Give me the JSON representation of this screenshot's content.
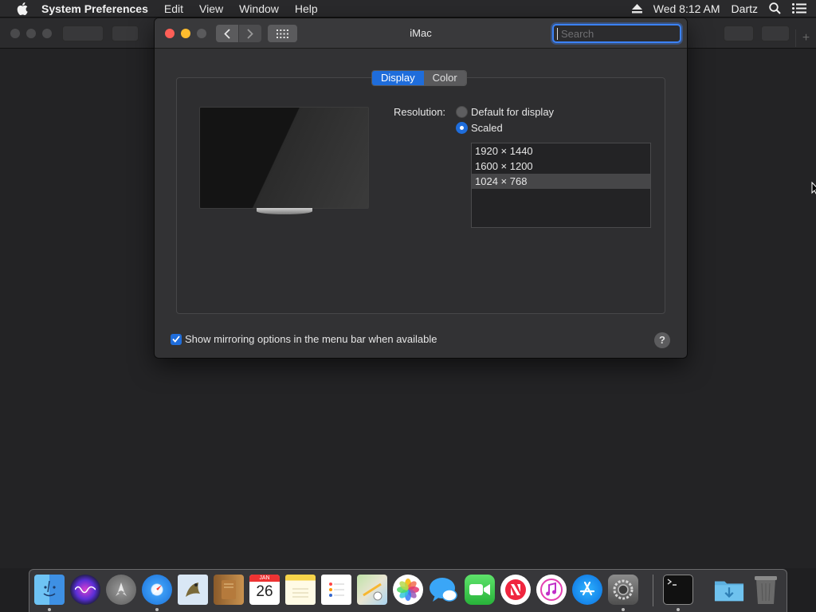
{
  "menubar": {
    "app_name": "System Preferences",
    "items": [
      "Edit",
      "View",
      "Window",
      "Help"
    ],
    "clock": "Wed 8:12 AM",
    "user": "Dartz"
  },
  "window": {
    "title": "iMac",
    "search_placeholder": "Search"
  },
  "tabs": [
    {
      "label": "Display",
      "active": true
    },
    {
      "label": "Color",
      "active": false
    }
  ],
  "resolution": {
    "label": "Resolution:",
    "options": [
      {
        "label": "Default for display",
        "selected": false
      },
      {
        "label": "Scaled",
        "selected": true
      }
    ],
    "scaled_list": [
      "1920 × 1440",
      "1600 × 1200",
      "1024 × 768"
    ],
    "scaled_selected": "1024 × 768"
  },
  "mirroring": {
    "label": "Show mirroring options in the menu bar when available",
    "checked": true
  },
  "help_label": "?",
  "dock": {
    "apps": [
      "Finder",
      "Siri",
      "Launchpad",
      "Safari",
      "Mail",
      "Contacts",
      "Calendar",
      "Notes",
      "Reminders",
      "Maps",
      "Photos",
      "Messages",
      "FaceTime",
      "News",
      "iTunes",
      "App Store",
      "System Preferences",
      "Terminal",
      "Downloads",
      "Trash"
    ],
    "calendar_month": "JAN",
    "calendar_day": "26"
  },
  "colors": {
    "accent": "#1f6ddb",
    "window_bg": "#323234",
    "close": "#ff5f57",
    "minimize": "#febc2e"
  }
}
